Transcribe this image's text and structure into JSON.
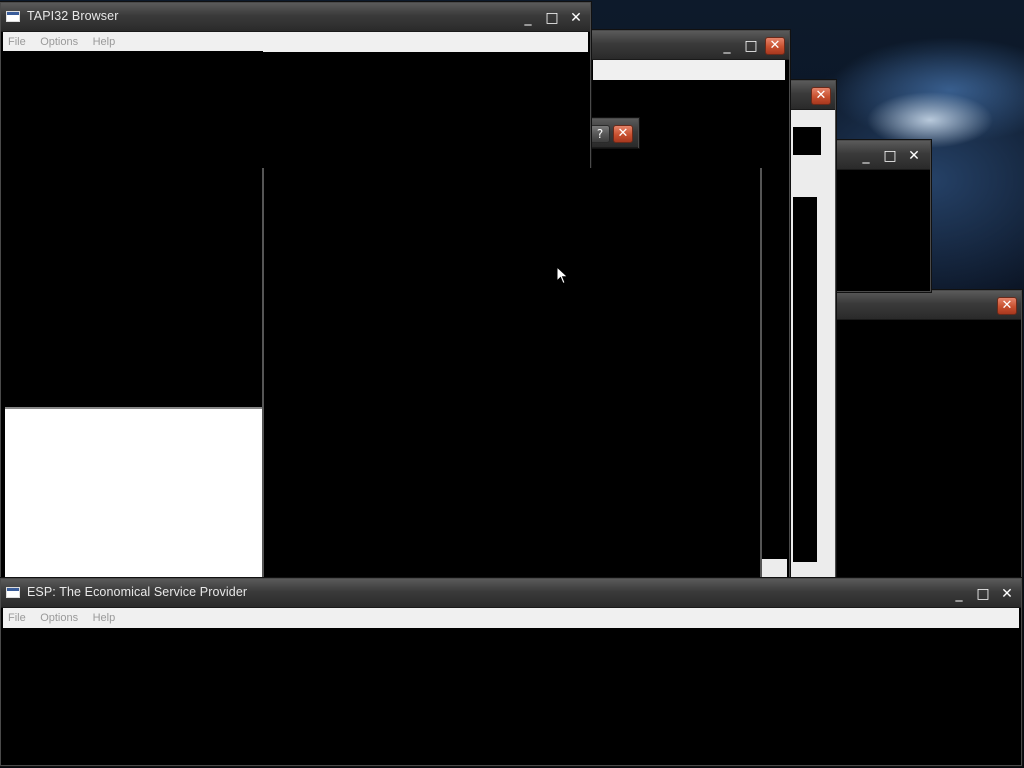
{
  "desktop": {
    "wallpaper": "dark storm sky"
  },
  "tapi_browser": {
    "title": "TAPI32 Browser",
    "menu": [
      "File",
      "Options",
      "Help"
    ],
    "controls": {
      "minimize": "_",
      "maximize": "□",
      "close": "✕"
    }
  },
  "esp_window": {
    "title": "ESP: The Economical Service Provider",
    "menu": [
      "File",
      "Options",
      "Help"
    ],
    "controls": {
      "minimize": "_",
      "maximize": "□",
      "close": "✕"
    }
  },
  "back_window_1": {
    "title": "",
    "controls": {
      "minimize": "_",
      "maximize": "□",
      "close": "✕"
    }
  },
  "back_window_2": {
    "title": "",
    "controls": {
      "close": "✕"
    }
  },
  "back_window_3": {
    "title": "",
    "controls": {
      "minimize": "_",
      "maximize": "□",
      "close": "✕"
    }
  },
  "back_window_4": {
    "title": "",
    "controls": {
      "close": "✕"
    }
  },
  "dialog_window": {
    "title": "",
    "controls": {
      "help": "?",
      "close": "✕"
    }
  },
  "colors": {
    "close_red": "#c8502f",
    "menubar": "#f0f0f0",
    "titlebar": "#3a3a3a"
  }
}
